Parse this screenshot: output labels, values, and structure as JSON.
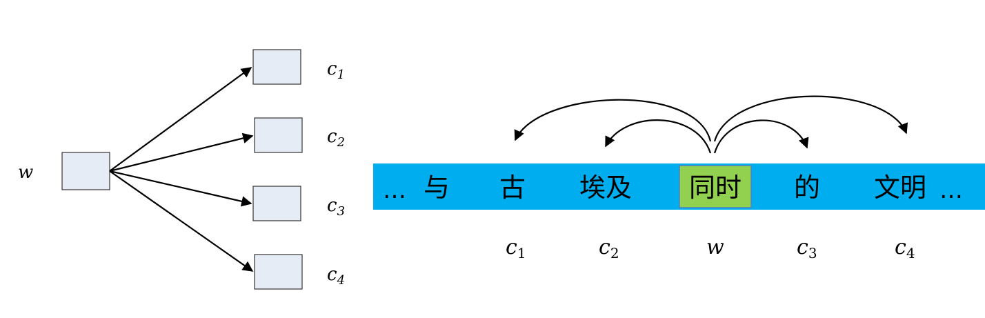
{
  "left_diagram": {
    "center_label": "w",
    "context_labels": [
      {
        "base": "c",
        "sub": "1"
      },
      {
        "base": "c",
        "sub": "2"
      },
      {
        "base": "c",
        "sub": "3"
      },
      {
        "base": "c",
        "sub": "4"
      }
    ]
  },
  "sentence": {
    "bar_color": "#00aeef",
    "highlight_fill": "#92d050",
    "highlight_text_color": "#5c7a1f",
    "ellipsis_start": "…",
    "ellipsis_end": "…",
    "tokens": [
      "与",
      "古",
      "埃及",
      "同时",
      "的",
      "文明"
    ],
    "highlight_token": "同时"
  },
  "bottom_labels": [
    {
      "base": "c",
      "sub": "1"
    },
    {
      "base": "c",
      "sub": "2"
    },
    {
      "base": "w",
      "sub": ""
    },
    {
      "base": "c",
      "sub": "3"
    },
    {
      "base": "c",
      "sub": "4"
    }
  ]
}
